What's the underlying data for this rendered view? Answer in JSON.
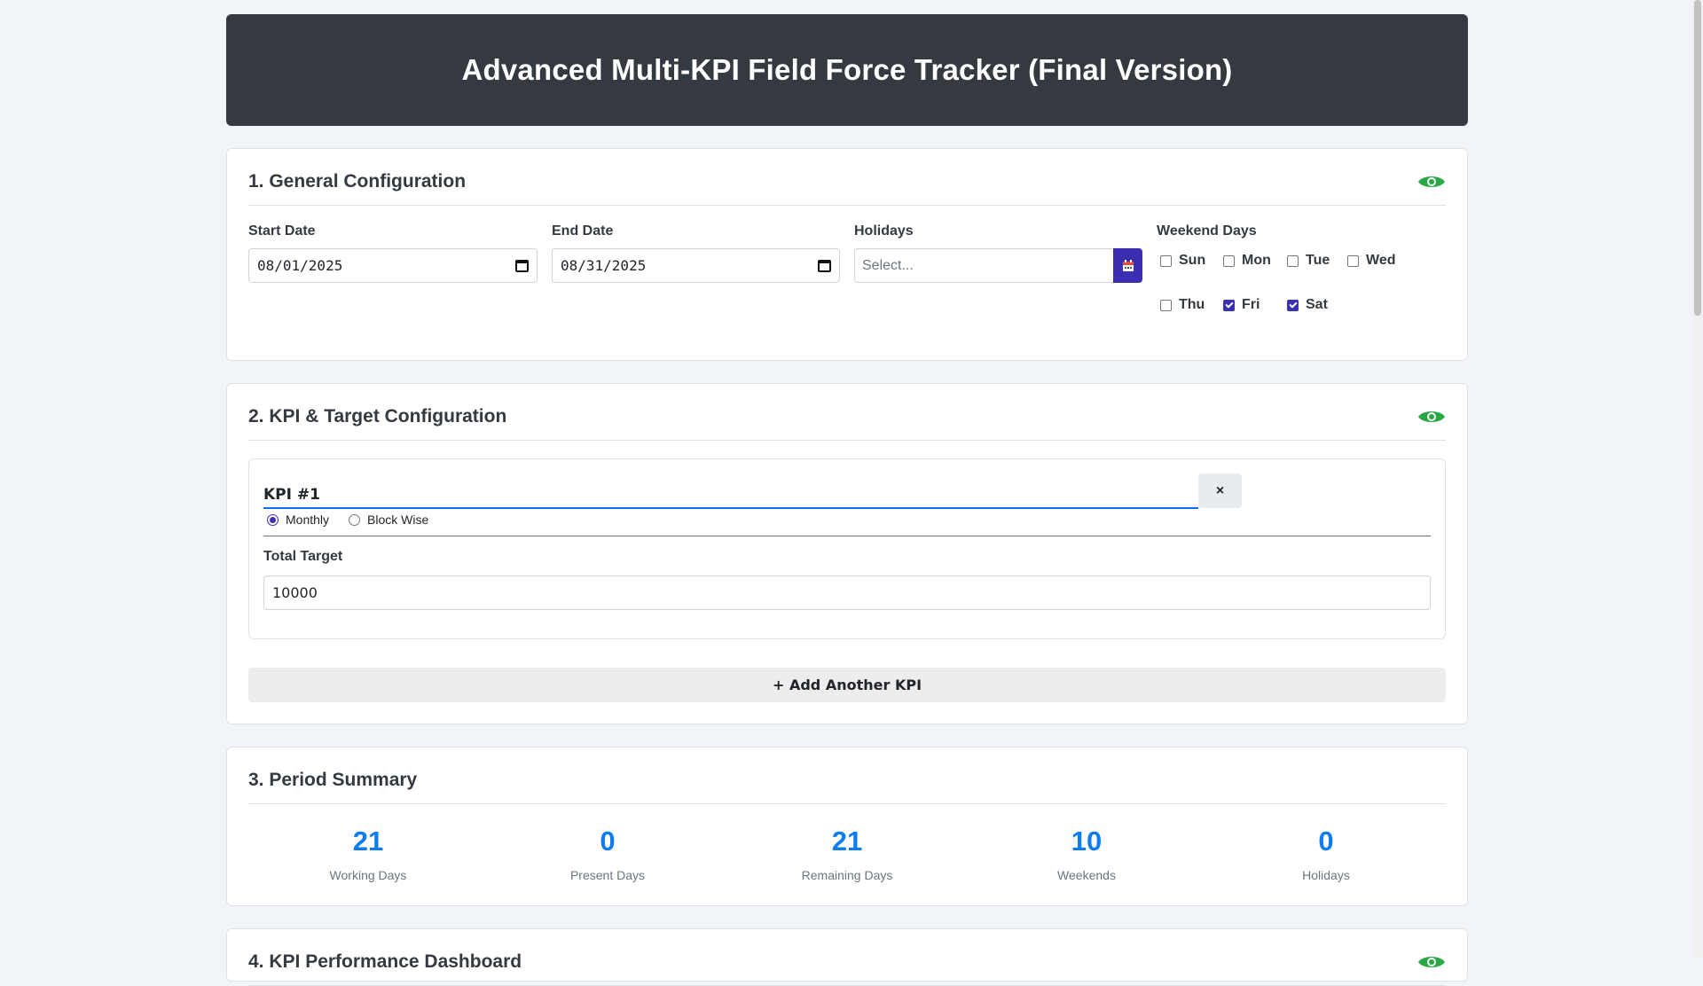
{
  "header": {
    "title": "Advanced Multi-KPI Field Force Tracker (Final Version)"
  },
  "general": {
    "title": "1. General Configuration",
    "start_label": "Start Date",
    "start_value": "08/01/2025",
    "end_label": "End Date",
    "end_value": "08/31/2025",
    "holidays_label": "Holidays",
    "holidays_placeholder": "Select...",
    "weekend_label": "Weekend Days",
    "weekdays": [
      {
        "label": "Sun",
        "checked": false
      },
      {
        "label": "Mon",
        "checked": false
      },
      {
        "label": "Tue",
        "checked": false
      },
      {
        "label": "Wed",
        "checked": false
      },
      {
        "label": "Thu",
        "checked": false
      },
      {
        "label": "Fri",
        "checked": true
      },
      {
        "label": "Sat",
        "checked": true
      }
    ]
  },
  "kpi": {
    "title": "2. KPI & Target Configuration",
    "kpi_name": "KPI #1",
    "close_label": "×",
    "mode_monthly": "Monthly",
    "mode_block": "Block Wise",
    "selected_mode": "Monthly",
    "target_label": "Total Target",
    "target_value": "10000",
    "add_label": "+ Add Another KPI"
  },
  "summary": {
    "title": "3. Period Summary",
    "stats": [
      {
        "value": "21",
        "label": "Working Days"
      },
      {
        "value": "0",
        "label": "Present Days"
      },
      {
        "value": "21",
        "label": "Remaining Days"
      },
      {
        "value": "10",
        "label": "Weekends"
      },
      {
        "value": "0",
        "label": "Holidays"
      }
    ]
  },
  "dashboard": {
    "title": "4. KPI Performance Dashboard"
  },
  "colors": {
    "accent": "#3a2fb0",
    "stat": "#0d7bf2",
    "eye": "#28a745",
    "header_bg": "#343a40"
  }
}
